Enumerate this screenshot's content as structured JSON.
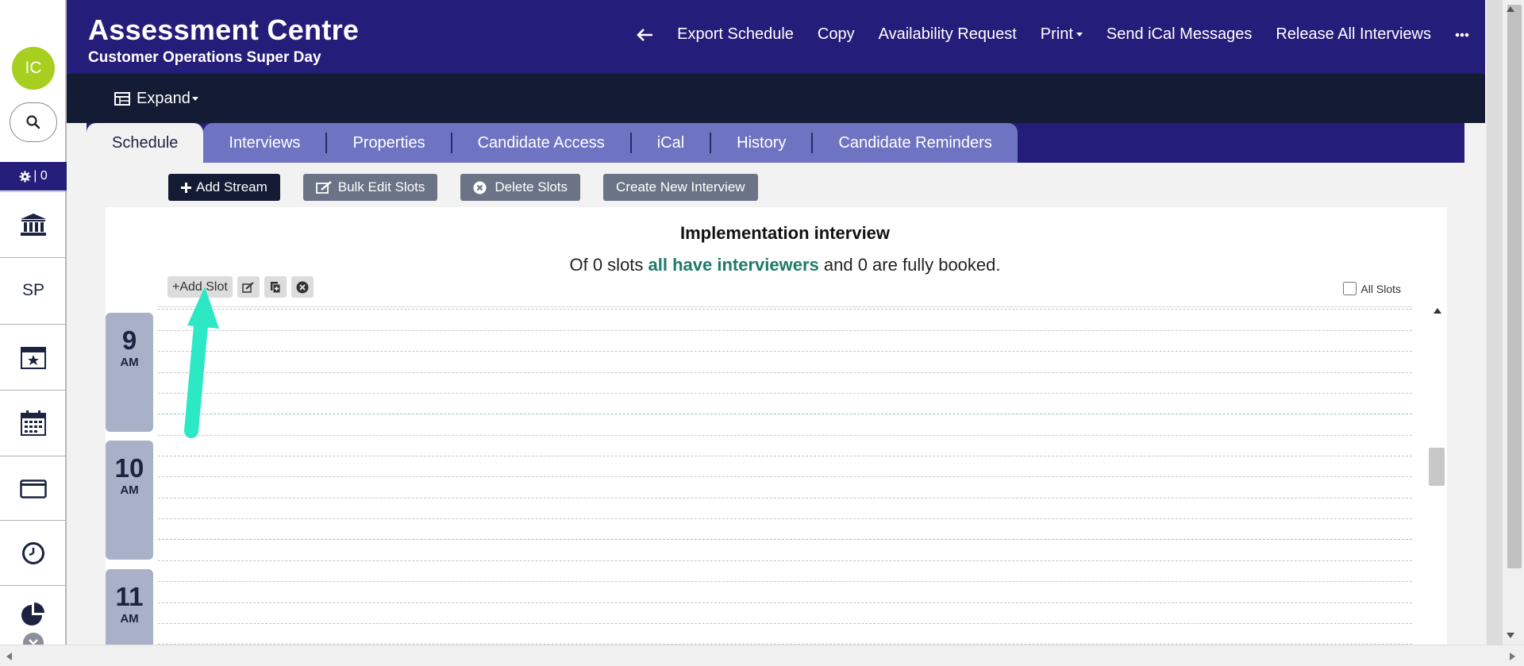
{
  "sidebar": {
    "avatar_initials": "IC",
    "gear_count": "| 0",
    "items": [
      {
        "icon": "bank-icon"
      },
      {
        "label": "SP"
      },
      {
        "icon": "calendar-star-icon"
      },
      {
        "icon": "calendar-icon"
      },
      {
        "icon": "envelope-icon"
      },
      {
        "icon": "clock-icon"
      },
      {
        "icon": "pie-chart-icon"
      }
    ]
  },
  "header": {
    "title": "Assessment Centre",
    "subtitle": "Customer Operations Super Day",
    "nav": {
      "export": "Export Schedule",
      "copy": "Copy",
      "availability": "Availability Request",
      "print": "Print",
      "ical": "Send iCal Messages",
      "release": "Release All Interviews"
    }
  },
  "subbar": {
    "expand": "Expand"
  },
  "tabs": {
    "active": "Schedule",
    "items": [
      "Interviews",
      "Properties",
      "Candidate Access",
      "iCal",
      "History",
      "Candidate Reminders"
    ]
  },
  "toolbar": {
    "add_stream": "Add Stream",
    "bulk_edit": "Bulk Edit Slots",
    "delete_slots": "Delete Slots",
    "create_interview": "Create New Interview"
  },
  "stream": {
    "title": "Implementation interview",
    "summary_pre": "Of 0 slots ",
    "summary_highlight": "all have interviewers",
    "summary_post": " and 0 are fully booked.",
    "add_slot": "+Add Slot",
    "all_slots": "All Slots"
  },
  "hours": [
    {
      "hour": "9",
      "ampm": "AM"
    },
    {
      "hour": "10",
      "ampm": "AM"
    },
    {
      "hour": "11",
      "ampm": "AM"
    }
  ],
  "colors": {
    "brand_primary": "#251d7a",
    "subbar": "#141b34",
    "tab_inactive": "#6f74c2",
    "accent_green": "#1e7a6a",
    "avatar": "#a6cf1f",
    "annotation_arrow": "#2de8c4"
  }
}
